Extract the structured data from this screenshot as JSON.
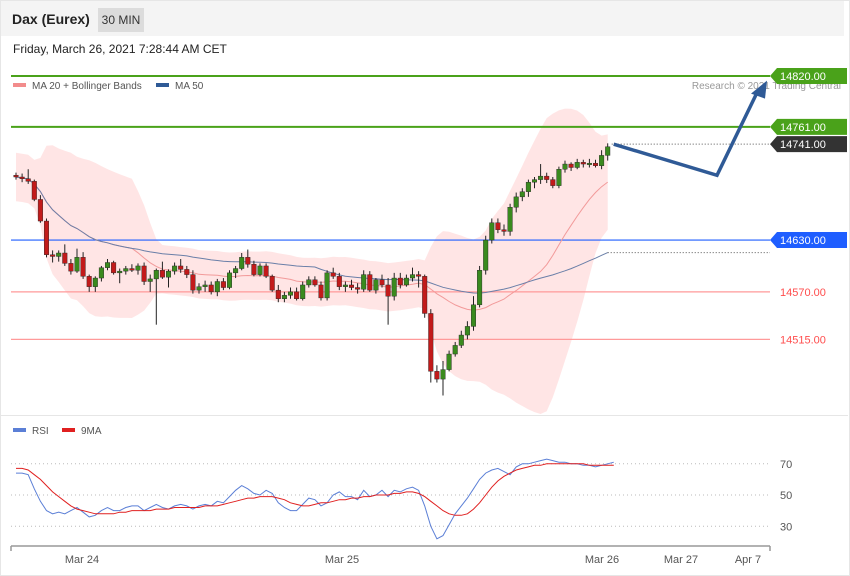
{
  "header": {
    "title": "Dax (Eurex)",
    "timeframe": "30 MIN"
  },
  "datetime": "Friday, March 26, 2021 7:28:44 AM CET",
  "legend": [
    {
      "label": "MA 20 + Bollinger Bands",
      "color": "#f28c8c"
    },
    {
      "label": "MA 50",
      "color": "#2f5a96"
    }
  ],
  "copyright": "Research © 2021 Trading Central",
  "rsi_legend": [
    {
      "label": "RSI",
      "color": "#5b7fd6"
    },
    {
      "label": "9MA",
      "color": "#e02020"
    }
  ],
  "chart_data": [
    {
      "type": "candlestick",
      "title": "Dax (Eurex)",
      "interval": "30 MIN",
      "ylim": [
        14395,
        14835
      ],
      "grid": false,
      "legend_position": "top-left",
      "x_labels": [
        "Mar 24",
        "Mar 25",
        "Mar 26",
        "Mar 27",
        "Apr 7"
      ],
      "levels": [
        {
          "value": 14820,
          "label": "14820.00",
          "color": "#4aa21a",
          "kind": "resistance"
        },
        {
          "value": 14761,
          "label": "14761.00",
          "color": "#4aa21a",
          "kind": "resistance"
        },
        {
          "value": 14741,
          "label": "14741.00",
          "color": "#333333",
          "kind": "last-price"
        },
        {
          "value": 14630,
          "label": "14630.00",
          "color": "#1f5eff",
          "kind": "pivot"
        },
        {
          "value": 14570,
          "label": "14570.00",
          "color": "#ff4d4d",
          "kind": "support"
        },
        {
          "value": 14515,
          "label": "14515.00",
          "color": "#ff4d4d",
          "kind": "support"
        }
      ],
      "forecast_path": [
        14741,
        14705,
        14810
      ],
      "candles": [
        [
          14705,
          14708,
          14700,
          14703
        ],
        [
          14703,
          14707,
          14697,
          14701
        ],
        [
          14701,
          14712,
          14695,
          14698
        ],
        [
          14698,
          14700,
          14675,
          14677
        ],
        [
          14677,
          14682,
          14650,
          14652
        ],
        [
          14652,
          14655,
          14610,
          14613
        ],
        [
          14613,
          14618,
          14604,
          14611
        ],
        [
          14611,
          14618,
          14605,
          14615
        ],
        [
          14615,
          14625,
          14600,
          14603
        ],
        [
          14603,
          14608,
          14590,
          14594
        ],
        [
          14594,
          14620,
          14592,
          14610
        ],
        [
          14610,
          14616,
          14585,
          14588
        ],
        [
          14588,
          14590,
          14570,
          14576
        ],
        [
          14576,
          14588,
          14570,
          14586
        ],
        [
          14586,
          14600,
          14582,
          14598
        ],
        [
          14598,
          14608,
          14595,
          14604
        ],
        [
          14604,
          14606,
          14590,
          14592
        ],
        [
          14592,
          14597,
          14580,
          14594
        ],
        [
          14594,
          14600,
          14590,
          14597
        ],
        [
          14597,
          14602,
          14593,
          14595
        ],
        [
          14595,
          14603,
          14590,
          14600
        ],
        [
          14600,
          14604,
          14578,
          14582
        ],
        [
          14582,
          14590,
          14570,
          14585
        ],
        [
          14585,
          14597,
          14532,
          14595
        ],
        [
          14595,
          14605,
          14585,
          14587
        ],
        [
          14587,
          14596,
          14575,
          14594
        ],
        [
          14594,
          14604,
          14590,
          14600
        ],
        [
          14600,
          14608,
          14592,
          14596
        ],
        [
          14596,
          14600,
          14586,
          14590
        ],
        [
          14590,
          14595,
          14568,
          14572
        ],
        [
          14572,
          14580,
          14568,
          14576
        ],
        [
          14576,
          14583,
          14570,
          14578
        ],
        [
          14578,
          14582,
          14567,
          14570
        ],
        [
          14570,
          14585,
          14565,
          14582
        ],
        [
          14582,
          14586,
          14572,
          14575
        ],
        [
          14575,
          14595,
          14573,
          14592
        ],
        [
          14592,
          14600,
          14586,
          14597
        ],
        [
          14597,
          14615,
          14595,
          14610
        ],
        [
          14610,
          14619,
          14598,
          14602
        ],
        [
          14602,
          14606,
          14588,
          14590
        ],
        [
          14590,
          14603,
          14588,
          14600
        ],
        [
          14600,
          14603,
          14586,
          14588
        ],
        [
          14588,
          14590,
          14570,
          14572
        ],
        [
          14572,
          14578,
          14558,
          14562
        ],
        [
          14562,
          14570,
          14558,
          14566
        ],
        [
          14566,
          14575,
          14562,
          14570
        ],
        [
          14570,
          14575,
          14560,
          14562
        ],
        [
          14562,
          14582,
          14560,
          14578
        ],
        [
          14578,
          14588,
          14575,
          14584
        ],
        [
          14584,
          14588,
          14576,
          14578
        ],
        [
          14578,
          14582,
          14560,
          14563
        ],
        [
          14563,
          14595,
          14560,
          14592
        ],
        [
          14592,
          14598,
          14585,
          14588
        ],
        [
          14588,
          14592,
          14572,
          14576
        ],
        [
          14576,
          14582,
          14570,
          14578
        ],
        [
          14578,
          14584,
          14572,
          14575
        ],
        [
          14575,
          14580,
          14568,
          14573
        ],
        [
          14573,
          14595,
          14570,
          14590
        ],
        [
          14590,
          14594,
          14570,
          14572
        ],
        [
          14572,
          14586,
          14568,
          14584
        ],
        [
          14584,
          14590,
          14575,
          14578
        ],
        [
          14578,
          14586,
          14532,
          14565
        ],
        [
          14565,
          14592,
          14560,
          14586
        ],
        [
          14586,
          14592,
          14574,
          14578
        ],
        [
          14578,
          14590,
          14576,
          14586
        ],
        [
          14586,
          14598,
          14582,
          14590
        ],
        [
          14590,
          14594,
          14575,
          14588
        ],
        [
          14588,
          14590,
          14540,
          14545
        ],
        [
          14545,
          14550,
          14465,
          14478
        ],
        [
          14478,
          14485,
          14465,
          14469
        ],
        [
          14469,
          14490,
          14450,
          14480
        ],
        [
          14480,
          14502,
          14478,
          14498
        ],
        [
          14498,
          14512,
          14495,
          14508
        ],
        [
          14508,
          14525,
          14505,
          14520
        ],
        [
          14520,
          14536,
          14515,
          14530
        ],
        [
          14530,
          14565,
          14525,
          14555
        ],
        [
          14555,
          14600,
          14552,
          14595
        ],
        [
          14595,
          14635,
          14590,
          14630
        ],
        [
          14630,
          14655,
          14626,
          14650
        ],
        [
          14650,
          14655,
          14638,
          14642
        ],
        [
          14642,
          14648,
          14635,
          14640
        ],
        [
          14640,
          14672,
          14635,
          14668
        ],
        [
          14668,
          14685,
          14662,
          14680
        ],
        [
          14680,
          14690,
          14675,
          14686
        ],
        [
          14686,
          14700,
          14680,
          14697
        ],
        [
          14697,
          14703,
          14690,
          14700
        ],
        [
          14700,
          14718,
          14695,
          14704
        ],
        [
          14704,
          14708,
          14696,
          14700
        ],
        [
          14700,
          14703,
          14690,
          14693
        ],
        [
          14693,
          14715,
          14690,
          14712
        ],
        [
          14712,
          14722,
          14708,
          14718
        ],
        [
          14718,
          14720,
          14710,
          14714
        ],
        [
          14714,
          14724,
          14712,
          14720
        ],
        [
          14720,
          14723,
          14714,
          14718
        ],
        [
          14718,
          14724,
          14714,
          14719
        ],
        [
          14719,
          14723,
          14714,
          14716
        ],
        [
          14716,
          14734,
          14712,
          14728
        ],
        [
          14728,
          14742,
          14722,
          14738
        ]
      ]
    },
    {
      "type": "line",
      "title": "RSI",
      "ylim": [
        18,
        82
      ],
      "ytick_labels": [
        "70",
        "50",
        "30"
      ],
      "series": [
        {
          "name": "RSI",
          "color": "#5b7fd6",
          "values": [
            64,
            64,
            63,
            54,
            46,
            40,
            38,
            39,
            38,
            40,
            42,
            39,
            36,
            37,
            40,
            42,
            40,
            40,
            42,
            43,
            43,
            40,
            42,
            44,
            42,
            41,
            43,
            44,
            43,
            41,
            43,
            44,
            43,
            46,
            45,
            49,
            53,
            56,
            54,
            51,
            50,
            53,
            51,
            45,
            42,
            40,
            40,
            44,
            48,
            47,
            43,
            45,
            50,
            52,
            49,
            49,
            47,
            53,
            49,
            50,
            53,
            49,
            53,
            52,
            54,
            55,
            53,
            43,
            30,
            22,
            24,
            31,
            38,
            43,
            48,
            54,
            60,
            64,
            66,
            67,
            65,
            63,
            68,
            70,
            70,
            71,
            72,
            73,
            72,
            71,
            71,
            70,
            70,
            69,
            69,
            68,
            69,
            70,
            71
          ]
        },
        {
          "name": "9MA",
          "color": "#e02020",
          "values": [
            67,
            67,
            66,
            63,
            60,
            56,
            52,
            49,
            46,
            43,
            41,
            40,
            39,
            38,
            38,
            38,
            38,
            39,
            39,
            40,
            40,
            40,
            40,
            41,
            41,
            41,
            42,
            42,
            42,
            42,
            42,
            43,
            43,
            43,
            44,
            45,
            46,
            47,
            48,
            48,
            49,
            49,
            49,
            48,
            47,
            45,
            44,
            43,
            43,
            44,
            45,
            45,
            46,
            47,
            47,
            48,
            48,
            49,
            49,
            50,
            50,
            50,
            51,
            51,
            52,
            52,
            51,
            49,
            46,
            43,
            40,
            38,
            37,
            37,
            38,
            41,
            45,
            50,
            55,
            59,
            62,
            64,
            66,
            67,
            68,
            69,
            69,
            70,
            70,
            70,
            70,
            70,
            70,
            70,
            69,
            69,
            69,
            69,
            69
          ]
        }
      ]
    }
  ]
}
